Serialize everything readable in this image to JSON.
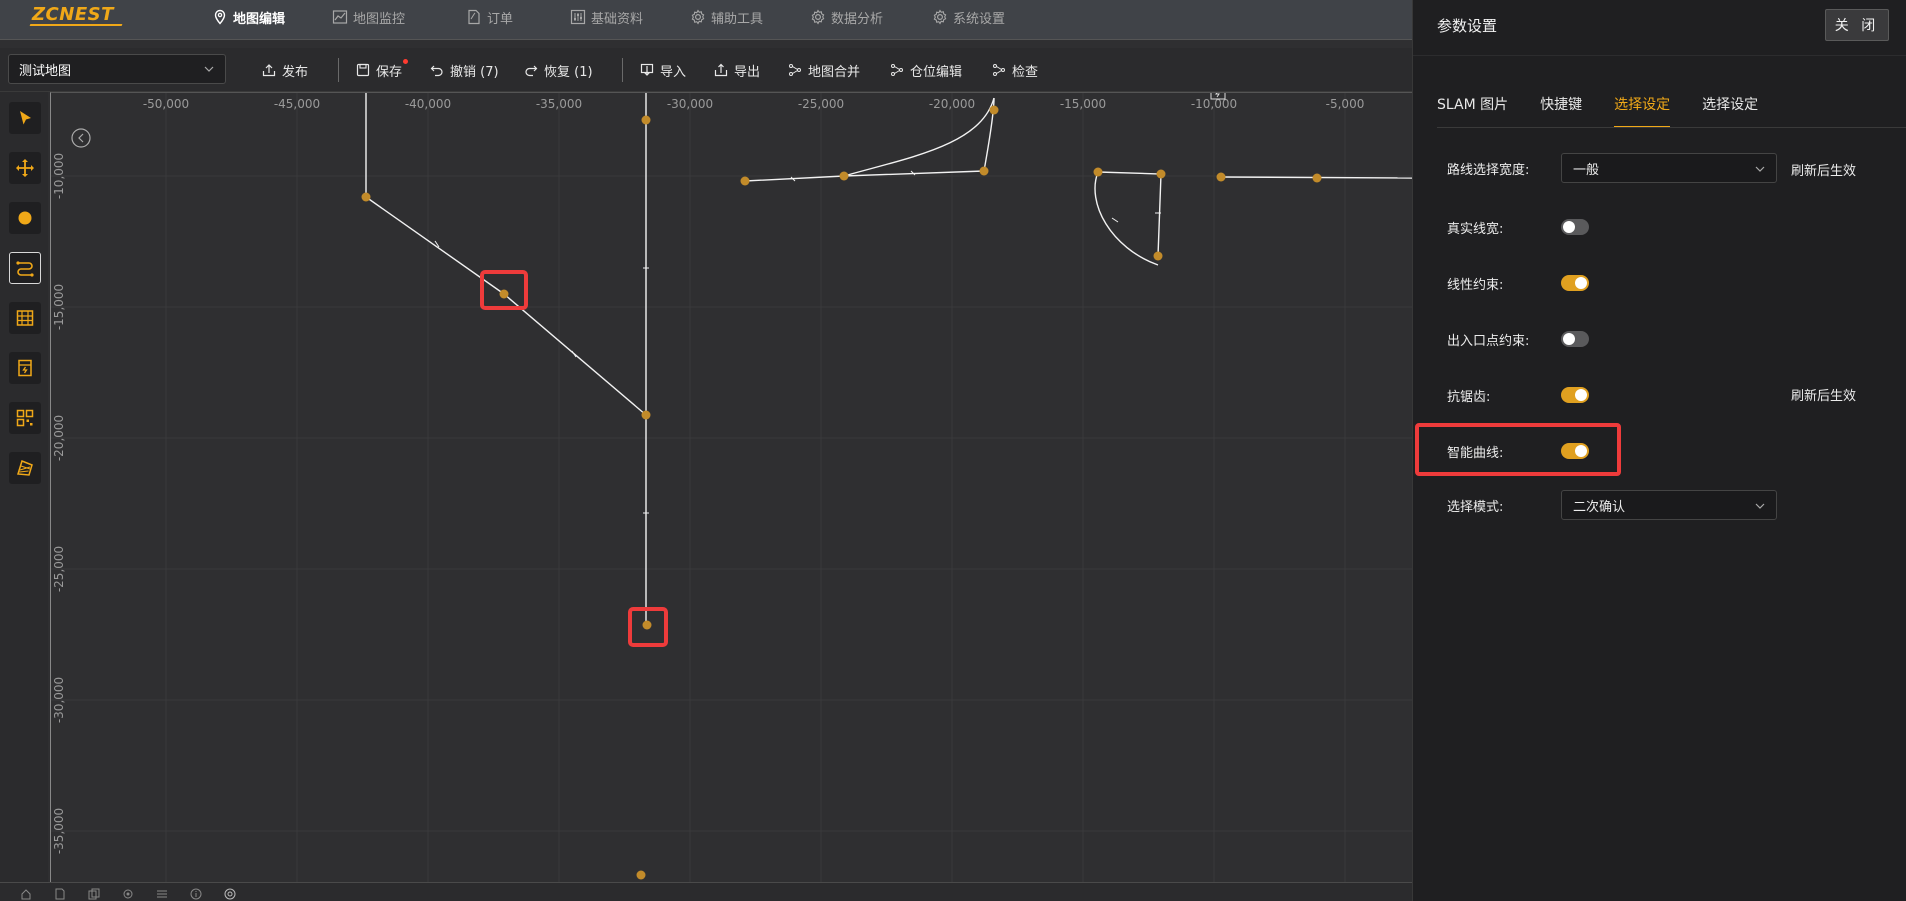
{
  "app": {
    "logo": "ZCNEST"
  },
  "nav": [
    {
      "label": "地图编辑",
      "icon": "map-pin-icon",
      "active": true
    },
    {
      "label": "地图监控",
      "icon": "chart-line-icon",
      "active": false
    },
    {
      "label": "订单",
      "icon": "document-icon",
      "active": false
    },
    {
      "label": "基础资料",
      "icon": "sliders-icon",
      "active": false
    },
    {
      "label": "辅助工具",
      "icon": "gear-icon",
      "active": false
    },
    {
      "label": "数据分析",
      "icon": "gear-icon",
      "active": false
    },
    {
      "label": "系统设置",
      "icon": "gear-icon",
      "active": false
    }
  ],
  "toolbar": {
    "map_name": "测试地图",
    "publish": "发布",
    "save": "保存",
    "undo": "撤销 (7)",
    "redo": "恢复 (1)",
    "import": "导入",
    "export": "导出",
    "merge": "地图合并",
    "location_edit": "仓位编辑",
    "check": "检查"
  },
  "ruler": {
    "x_labels": [
      "-50,000",
      "-45,000",
      "-40,000",
      "-35,000",
      "-30,000",
      "-25,000",
      "-20,000",
      "-15,000",
      "-10,000",
      "-5,000"
    ],
    "y_labels": [
      "-10,000",
      "-15,000",
      "-20,000",
      "-25,000",
      "-30,000",
      "-35,000"
    ]
  },
  "tools": [
    "pointer-icon",
    "move-icon",
    "point-icon",
    "route-icon",
    "shelf-icon",
    "charger-icon",
    "qr-icon",
    "area-icon"
  ],
  "panel": {
    "title": "参数设置",
    "close": "关 闭",
    "tabs": [
      {
        "label": "SLAM 图片",
        "active": false
      },
      {
        "label": "快捷键",
        "active": false
      },
      {
        "label": "选择设定",
        "active": true
      },
      {
        "label": "选择设定",
        "active": false
      }
    ],
    "route_width_label": "路线选择宽度:",
    "route_width_value": "一般",
    "refresh_hint_1": "刷新后生效",
    "real_width_label": "真实线宽:",
    "real_width_on": false,
    "linear_label": "线性约束:",
    "linear_on": true,
    "entry_label": "出入口点约束:",
    "entry_on": false,
    "antialias_label": "抗锯齿:",
    "antialias_on": true,
    "refresh_hint_2": "刷新后生效",
    "smart_curve_label": "智能曲线:",
    "smart_curve_on": true,
    "select_mode_label": "选择模式:",
    "select_mode_value": "二次确认"
  }
}
